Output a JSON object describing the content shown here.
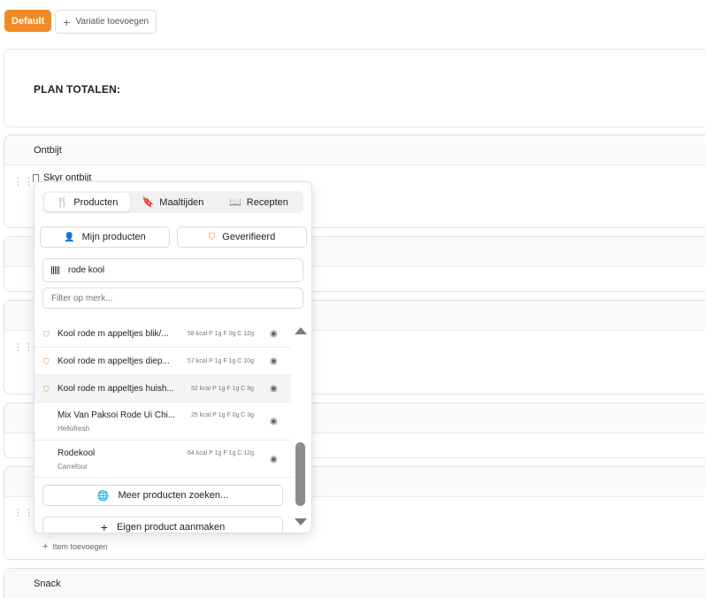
{
  "topbar": {
    "default_label": "Default",
    "add_variation_label": "Variatie toevoegen"
  },
  "plan": {
    "title": "PLAN TOTALEN:"
  },
  "sections": {
    "breakfast": "Ontbijt",
    "snack": "Snack"
  },
  "breakfast_item": {
    "label": "Skyr ontbijt"
  },
  "add_item_label": "Item toevoegen",
  "popover": {
    "tabs": [
      {
        "label": "Producten",
        "icon": "utensils-icon"
      },
      {
        "label": "Maaltijden",
        "icon": "bookmark-icon"
      },
      {
        "label": "Recepten",
        "icon": "book-icon"
      }
    ],
    "my_products_label": "Mijn producten",
    "verified_label": "Geverifieerd",
    "search_value": "rode kool",
    "brand_placeholder": "Filter op merk...",
    "products": [
      {
        "name": "Kool rode m appeltjes blik/...",
        "macros": "58 kcal  P 1g  F 0g  C 12g",
        "verified": true
      },
      {
        "name": "Kool rode m appeltjes diep...",
        "macros": "57 kcal  P 1g  F 1g  C 10g",
        "verified": true
      },
      {
        "name": "Kool rode m appeltjes huish...",
        "macros": "52 kcal  P 1g  F 1g  C 8g",
        "verified": true
      },
      {
        "name": "Mix Van Paksoi Rode Ui Chi...",
        "brand": "Hellofresh",
        "macros": "25 kcal  P 1g  F 0g  C 3g",
        "verified": false
      },
      {
        "name": "Rodekool",
        "brand": "Carrefour",
        "macros": "64 kcal  P 1g  F 1g  C 12g",
        "verified": false
      }
    ],
    "more_products_label": "Meer producten zoeken...",
    "create_product_label": "Eigen product aanmaken"
  },
  "colors": {
    "accent": "#f08a24"
  }
}
